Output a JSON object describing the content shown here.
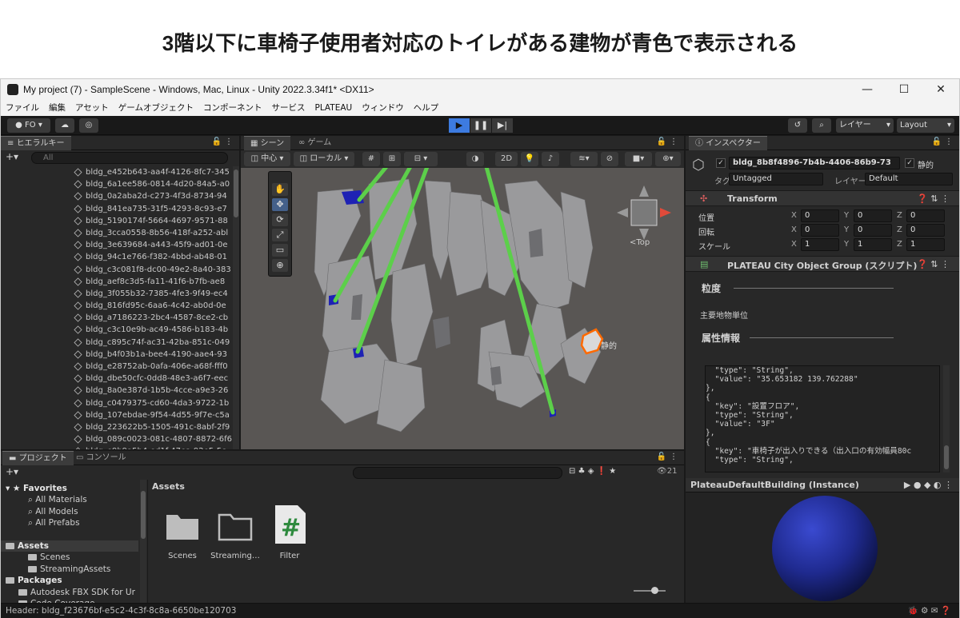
{
  "annotation": {
    "text": "3階以下に車椅子使用者対応のトイレがある建物が青色で表示される",
    "arrow_color": "#5ccf4a"
  },
  "window": {
    "title": "My project (7) - SampleScene - Windows, Mac, Linux - Unity 2022.3.34f1* <DX11>",
    "controls": {
      "minimize": "—",
      "maximize": "☐",
      "close": "✕"
    }
  },
  "menu": [
    "ファイル",
    "編集",
    "アセット",
    "ゲームオブジェクト",
    "コンポーネント",
    "サービス",
    "PLATEAU",
    "ウィンドウ",
    "ヘルプ"
  ],
  "toolbar": {
    "account": "FO",
    "layers_dropdown": "レイヤー",
    "layout_dropdown": "Layout"
  },
  "hierarchy": {
    "tab": "ヒエラルキー",
    "search_placeholder": "All",
    "items": [
      "bldg_e452b643-aa4f-4126-8fc7-345",
      "bldg_6a1ee586-0814-4d20-84a5-a0",
      "bldg_0a2aba2d-c273-4f3d-8734-94",
      "bldg_841ea735-31f5-4293-8c93-e7",
      "bldg_5190174f-5664-4697-9571-88",
      "bldg_3cca0558-8b56-418f-a252-abl",
      "bldg_3e639684-a443-45f9-ad01-0e",
      "bldg_94c1e766-f382-4bbd-ab48-01",
      "bldg_c3c081f8-dc00-49e2-8a40-383",
      "bldg_aef8c3d5-fa11-41f6-b7fb-ae8",
      "bldg_3f055b32-7385-4fe3-9f49-ec4",
      "bldg_816fd95c-6aa6-4c42-ab0d-0e",
      "bldg_a7186223-2bc4-4587-8ce2-cb",
      "bldg_c3c10e9b-ac49-4586-b183-4b",
      "bldg_c895c74f-ac31-42ba-851c-049",
      "bldg_b4f03b1a-bee4-4190-aae4-93",
      "bldg_e28752ab-0afa-406e-a68f-fff0",
      "bldg_dbe50cfc-0dd8-48e3-a6f7-eec",
      "bldg_8a0e387d-1b5b-4cce-a9e3-26",
      "bldg_c0479375-cd60-4da3-9722-1b",
      "bldg_107ebdae-9f54-4d55-9f7e-c5a",
      "bldg_223622b5-1505-491c-8abf-2f9",
      "bldg_089c0023-081c-4807-8872-6f6",
      "bldg_e9b9a5b4-ed1f-47ea-92e5-5c",
      "bldg_8b8f4896-7b4b-4406-86b9-73"
    ],
    "selected_index": 24
  },
  "scene": {
    "tabs": [
      "シーン",
      "ゲーム"
    ],
    "pivot": "中心",
    "space": "ローカル",
    "mode_2d": "2D",
    "gizmo_label": "<Top",
    "selected_label": "静的",
    "tools": [
      "✋",
      "✥",
      "⟳",
      "⤢",
      "▭",
      "⊕"
    ]
  },
  "inspector": {
    "tab": "インスペクター",
    "object_name": "bldg_8b8f4896-7b4b-4406-86b9-73",
    "static_label": "静的",
    "tag_label": "タグ",
    "tag_value": "Untagged",
    "layer_label": "レイヤー",
    "layer_value": "Default",
    "transform": {
      "title": "Transform",
      "position_label": "位置",
      "rotation_label": "回転",
      "scale_label": "スケール",
      "position": [
        "0",
        "0",
        "0"
      ],
      "rotation": [
        "0",
        "0",
        "0"
      ],
      "scale": [
        "1",
        "1",
        "1"
      ],
      "axes": [
        "X",
        "Y",
        "Z"
      ]
    },
    "script": {
      "title": "PLATEAU City Object Group (スクリプト)",
      "granularity_label": "粒度",
      "granularity_value": "主要地物単位",
      "attributes_label": "属性情報"
    },
    "json_lines": [
      "  \"type\": \"String\",",
      "  \"value\": \"35.653182 139.762288\"",
      "},",
      "{",
      "  \"key\": \"設置フロア\",",
      "  \"type\": \"String\",",
      "  \"value\": \"3F\"",
      "},",
      "{",
      "  \"key\": \"車椅子が出入りできる（出入口の有効幅員80c",
      "  \"type\": \"String\","
    ]
  },
  "preview": {
    "title": "PlateauDefaultBuilding (Instance)",
    "sphere_color": "#1f2a8f"
  },
  "project": {
    "tabs": [
      "プロジェクト",
      "コンソール"
    ],
    "count": "21",
    "tree": {
      "favorites": "Favorites",
      "favorite_items": [
        "All Materials",
        "All Models",
        "All Prefabs"
      ],
      "assets": "Assets",
      "asset_items": [
        "Scenes",
        "StreamingAssets"
      ],
      "packages": "Packages",
      "package_items": [
        "Autodesk FBX SDK for Ur",
        "Code Coverage"
      ]
    },
    "breadcrumb": "Assets",
    "assets": [
      {
        "name": "Scenes",
        "icon": "folder-filled"
      },
      {
        "name": "Streaming…",
        "icon": "folder-outline"
      },
      {
        "name": "Filter",
        "icon": "csharp-script"
      }
    ]
  },
  "status": {
    "text": "Header: bldg_f23676bf-e5c2-4c3f-8c8a-6650be120703"
  },
  "colors": {
    "highlight_building": "#1e22b4",
    "selected_outline": "#ff6a00",
    "selection_row": "#2c5d87",
    "play_accent": "#3d7be0"
  }
}
